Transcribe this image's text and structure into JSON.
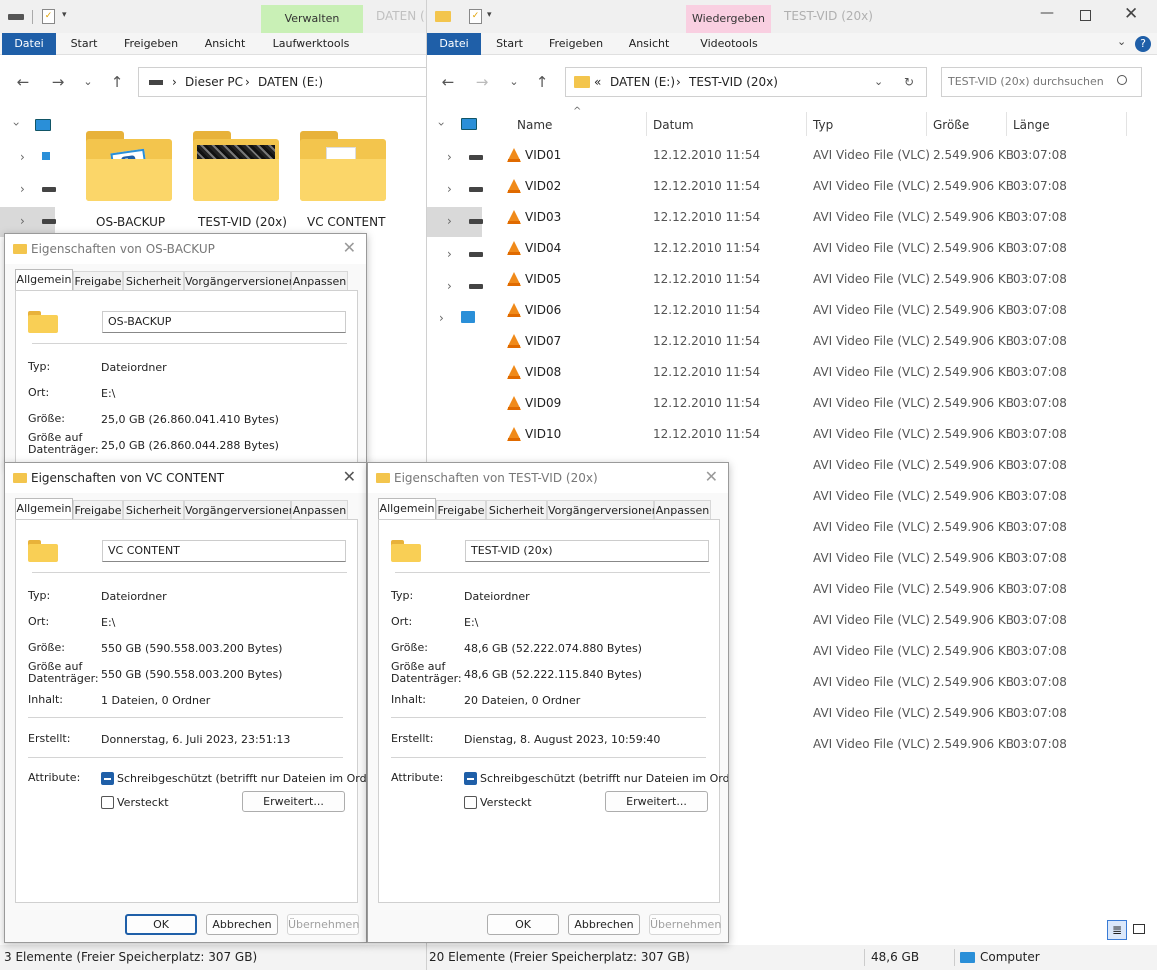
{
  "left_window": {
    "context_tab": "Verwalten",
    "title_faded": "DATEN (E:)",
    "ribbon_tabs": [
      "Datei",
      "Start",
      "Freigeben",
      "Ansicht",
      "Laufwerktools"
    ],
    "breadcrumb": [
      "Dieser PC",
      "DATEN (E:)"
    ],
    "folders": [
      "OS-BACKUP",
      "TEST-VID (20x)",
      "VC CONTENT"
    ],
    "status": "3 Elemente (Freier Speicherplatz: 307 GB)"
  },
  "right_window": {
    "context_tab": "Wiedergeben",
    "title": "TEST-VID (20x)",
    "ribbon_tabs": [
      "Datei",
      "Start",
      "Freigeben",
      "Ansicht",
      "Videotools"
    ],
    "breadcrumb_prefix": "«",
    "breadcrumb": [
      "DATEN (E:)",
      "TEST-VID (20x)"
    ],
    "search_placeholder": "TEST-VID (20x) durchsuchen",
    "columns": [
      "Name",
      "Datum",
      "Typ",
      "Größe",
      "Länge"
    ],
    "files": [
      {
        "name": "VID01",
        "date": "12.12.2010 11:54",
        "type": "AVI Video File (VLC)",
        "size": "2.549.906 KB",
        "length": "03:07:08"
      },
      {
        "name": "VID02",
        "date": "12.12.2010 11:54",
        "type": "AVI Video File (VLC)",
        "size": "2.549.906 KB",
        "length": "03:07:08"
      },
      {
        "name": "VID03",
        "date": "12.12.2010 11:54",
        "type": "AVI Video File (VLC)",
        "size": "2.549.906 KB",
        "length": "03:07:08"
      },
      {
        "name": "VID04",
        "date": "12.12.2010 11:54",
        "type": "AVI Video File (VLC)",
        "size": "2.549.906 KB",
        "length": "03:07:08"
      },
      {
        "name": "VID05",
        "date": "12.12.2010 11:54",
        "type": "AVI Video File (VLC)",
        "size": "2.549.906 KB",
        "length": "03:07:08"
      },
      {
        "name": "VID06",
        "date": "12.12.2010 11:54",
        "type": "AVI Video File (VLC)",
        "size": "2.549.906 KB",
        "length": "03:07:08"
      },
      {
        "name": "VID07",
        "date": "12.12.2010 11:54",
        "type": "AVI Video File (VLC)",
        "size": "2.549.906 KB",
        "length": "03:07:08"
      },
      {
        "name": "VID08",
        "date": "12.12.2010 11:54",
        "type": "AVI Video File (VLC)",
        "size": "2.549.906 KB",
        "length": "03:07:08"
      },
      {
        "name": "VID09",
        "date": "12.12.2010 11:54",
        "type": "AVI Video File (VLC)",
        "size": "2.549.906 KB",
        "length": "03:07:08"
      },
      {
        "name": "VID10",
        "date": "12.12.2010 11:54",
        "type": "AVI Video File (VLC)",
        "size": "2.549.906 KB",
        "length": "03:07:08"
      }
    ],
    "partial_rows": [
      {
        "type": "AVI Video File (VLC)",
        "size": "2.549.906 KB",
        "length": "03:07:08"
      },
      {
        "type": "AVI Video File (VLC)",
        "size": "2.549.906 KB",
        "length": "03:07:08"
      },
      {
        "type": "AVI Video File (VLC)",
        "size": "2.549.906 KB",
        "length": "03:07:08"
      },
      {
        "type": "AVI Video File (VLC)",
        "size": "2.549.906 KB",
        "length": "03:07:08"
      },
      {
        "type": "AVI Video File (VLC)",
        "size": "2.549.906 KB",
        "length": "03:07:08"
      },
      {
        "type": "AVI Video File (VLC)",
        "size": "2.549.906 KB",
        "length": "03:07:08"
      },
      {
        "type": "AVI Video File (VLC)",
        "size": "2.549.906 KB",
        "length": "03:07:08"
      },
      {
        "type": "AVI Video File (VLC)",
        "size": "2.549.906 KB",
        "length": "03:07:08"
      },
      {
        "type": "AVI Video File (VLC)",
        "size": "2.549.906 KB",
        "length": "03:07:08"
      },
      {
        "type": "AVI Video File (VLC)",
        "size": "2.549.906 KB",
        "length": "03:07:08"
      }
    ],
    "status": "20 Elemente (Freier Speicherplatz: 307 GB)",
    "status_size": "48,6 GB",
    "status_location": "Computer"
  },
  "dialog_tabs": [
    "Allgemein",
    "Freigabe",
    "Sicherheit",
    "Vorgängerversionen",
    "Anpassen"
  ],
  "labels": {
    "typ": "Typ:",
    "ort": "Ort:",
    "groesse": "Größe:",
    "groesse_auf": "Größe auf",
    "datentraeger": "Datenträger:",
    "inhalt": "Inhalt:",
    "erstellt": "Erstellt:",
    "attribute": "Attribute:",
    "readonly": "Schreibgeschützt (betrifft nur Dateien im Ordner)",
    "hidden": "Versteckt",
    "advanced": "Erweitert...",
    "ok": "OK",
    "cancel": "Abbrechen",
    "apply": "Übernehmen"
  },
  "dlg_os": {
    "title": "Eigenschaften von OS-BACKUP",
    "name": "OS-BACKUP",
    "typ": "Dateiordner",
    "ort": "E:\\",
    "size": "25,0 GB (26.860.041.410 Bytes)",
    "size_disk": "25,0 GB (26.860.044.288 Bytes)"
  },
  "dlg_vc": {
    "title": "Eigenschaften von VC CONTENT",
    "name": "VC CONTENT",
    "typ": "Dateiordner",
    "ort": "E:\\",
    "size": "550 GB (590.558.003.200 Bytes)",
    "size_disk": "550 GB (590.558.003.200 Bytes)",
    "content": "1 Dateien, 0 Ordner",
    "created": "Donnerstag, 6. Juli 2023, 23:51:13"
  },
  "dlg_tv": {
    "title": "Eigenschaften von TEST-VID (20x)",
    "name": "TEST-VID (20x)",
    "typ": "Dateiordner",
    "ort": "E:\\",
    "size": "48,6 GB (52.222.074.880 Bytes)",
    "size_disk": "48,6 GB (52.222.115.840 Bytes)",
    "content": "20 Dateien, 0 Ordner",
    "created": "Dienstag, 8. August 2023, 10:59:40"
  }
}
